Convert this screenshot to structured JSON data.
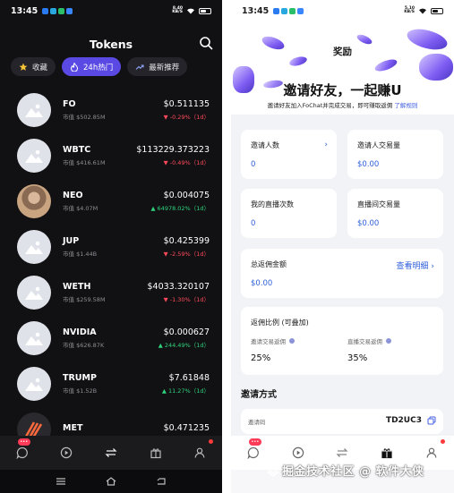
{
  "left": {
    "status": {
      "time": "13:45",
      "net_top": "8.40",
      "net_bottom": "KB/S",
      "battery": 60
    },
    "header": {
      "title": "Tokens"
    },
    "chips": [
      {
        "label": "收藏",
        "icon": "star-icon"
      },
      {
        "label": "24h热门",
        "icon": "flame-icon",
        "active": true
      },
      {
        "label": "最新推荐",
        "icon": "trending-icon"
      }
    ],
    "tokens": [
      {
        "symbol": "FO",
        "mcap": "市值 $502.85M",
        "price": "$0.511135",
        "change": "-0.29%（1d）",
        "dir": "down",
        "avatar": "placeholder"
      },
      {
        "symbol": "WBTC",
        "mcap": "市值 $416.61M",
        "price": "$113229.373223",
        "change": "-0.49%（1d）",
        "dir": "down",
        "avatar": "placeholder"
      },
      {
        "symbol": "NEO",
        "mcap": "市值 $4.07M",
        "price": "$0.004075",
        "change": "64978.02%（1d）",
        "dir": "up",
        "avatar": "photo"
      },
      {
        "symbol": "JUP",
        "mcap": "市值 $1.44B",
        "price": "$0.425399",
        "change": "-2.59%（1d）",
        "dir": "down",
        "avatar": "placeholder"
      },
      {
        "symbol": "WETH",
        "mcap": "市值 $259.58M",
        "price": "$4033.320107",
        "change": "-1.30%（1d）",
        "dir": "down",
        "avatar": "placeholder"
      },
      {
        "symbol": "NVIDIA",
        "mcap": "市值 $626.87K",
        "price": "$0.000627",
        "change": "244.49%（1d）",
        "dir": "up",
        "avatar": "placeholder"
      },
      {
        "symbol": "TRUMP",
        "mcap": "市值 $1.52B",
        "price": "$7.61848",
        "change": "11.27%（1d）",
        "dir": "up",
        "avatar": "placeholder"
      },
      {
        "symbol": "MET",
        "mcap": "",
        "price": "$0.471235",
        "change": "",
        "dir": "",
        "avatar": "met"
      }
    ],
    "nav": {
      "badge": "•••"
    }
  },
  "right": {
    "status": {
      "time": "13:45",
      "net_top": "5.10",
      "net_bottom": "KB/S",
      "battery": 60
    },
    "title": "奖励",
    "headline": "邀请好友，一起赚U",
    "sub": "邀请好友加入FoChat并完成交易，即可赚取返佣",
    "sub_link": "了解规则",
    "stats": [
      {
        "label": "邀请人数",
        "value": "0",
        "chevron": "›"
      },
      {
        "label": "邀请人交易量",
        "value": "$0.00"
      },
      {
        "label": "我的直播次数",
        "value": "0"
      },
      {
        "label": "直播间交易量",
        "value": "$0.00"
      }
    ],
    "commission": {
      "label": "总返佣金额",
      "value": "$0.00",
      "link": "查看明细 ›"
    },
    "ratio": {
      "title": "返佣比例 (可叠加)",
      "items": [
        {
          "label": "邀请交易返佣",
          "value": "25%"
        },
        {
          "label": "直播交易返佣",
          "value": "35%"
        }
      ]
    },
    "invite": {
      "title": "邀请方式",
      "code_label": "邀请码",
      "code": "TD2UC3"
    },
    "nav": {
      "badge": "•••"
    }
  },
  "watermark": "掘金技术社区 @ 软件大侠",
  "colors": {
    "accent": "#5a4ae3",
    "down": "#ff4a5a",
    "up": "#2fd37d",
    "link": "#2f5fd9"
  }
}
